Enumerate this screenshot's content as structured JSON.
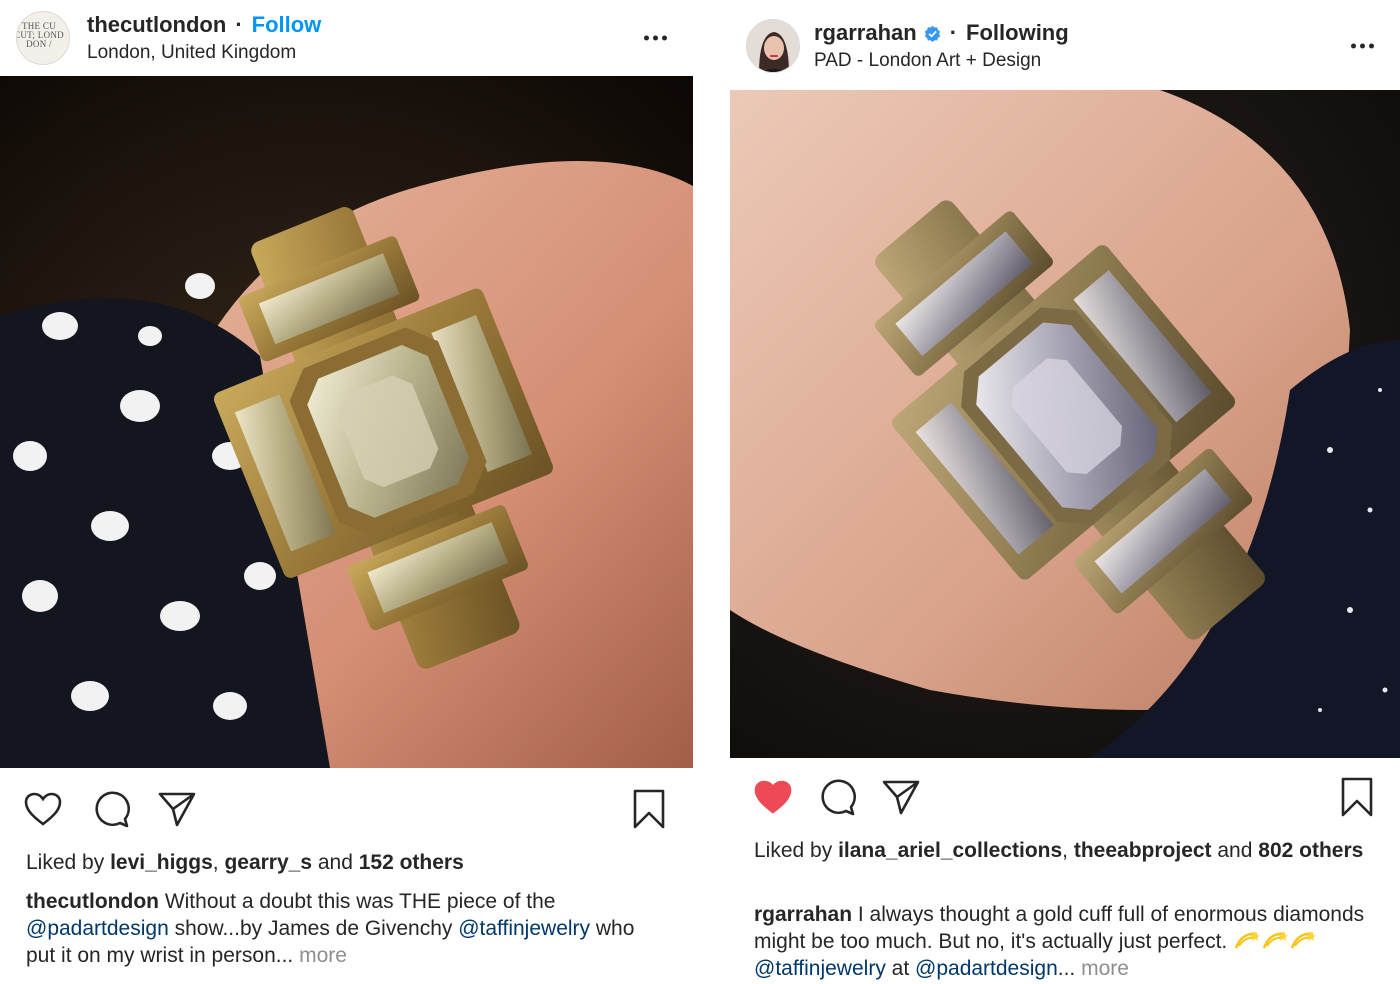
{
  "left_post": {
    "avatar_text": [
      "THE CU",
      "CUT; LOND",
      "DON /"
    ],
    "username": "thecutlondon",
    "dot": "·",
    "follow_label": "Follow",
    "location": "London, United Kingdom",
    "likes": {
      "prefix": "Liked by ",
      "user1": "levi_higgs",
      "sep": ", ",
      "user2": "gearry_s",
      "mid": " and ",
      "count": "152 others"
    },
    "caption": {
      "author": "thecutlondon",
      "text1": " Without a doubt this was THE piece of the ",
      "mention1": "@padartdesign",
      "text2": " show...by James de Givenchy ",
      "mention2": "@taffinjewelry",
      "text3": " who put it on my wrist in person... ",
      "more": "more"
    }
  },
  "right_post": {
    "username": "rgarrahan",
    "dot": "·",
    "following_label": "Following",
    "location": "PAD - London Art + Design",
    "liked": true,
    "likes": {
      "prefix": "Liked by ",
      "user1": "ilana_ariel_collections",
      "sep": ", ",
      "user2": "theeabproject",
      "mid": " and ",
      "count": "802 others"
    },
    "caption": {
      "author": "rgarrahan",
      "text1": " I always thought a gold cuff full of enormous diamonds might be too much. But no, it's actually just perfect. ",
      "emojis": [
        "dizzy-emoji",
        "dizzy-emoji",
        "dizzy-emoji"
      ],
      "mention1": "@taffinjewelry",
      "text2": " at ",
      "mention2": "@padartdesign",
      "text3": "... ",
      "more": "more"
    }
  },
  "colors": {
    "text": "#262626",
    "follow_blue": "#0095f6",
    "mention": "#00376b",
    "muted": "#8e8e8e",
    "like_red": "#ed4956"
  },
  "icons": [
    "heart-icon",
    "comment-icon",
    "share-icon",
    "bookmark-icon",
    "more-options-icon",
    "verified-badge-icon"
  ]
}
